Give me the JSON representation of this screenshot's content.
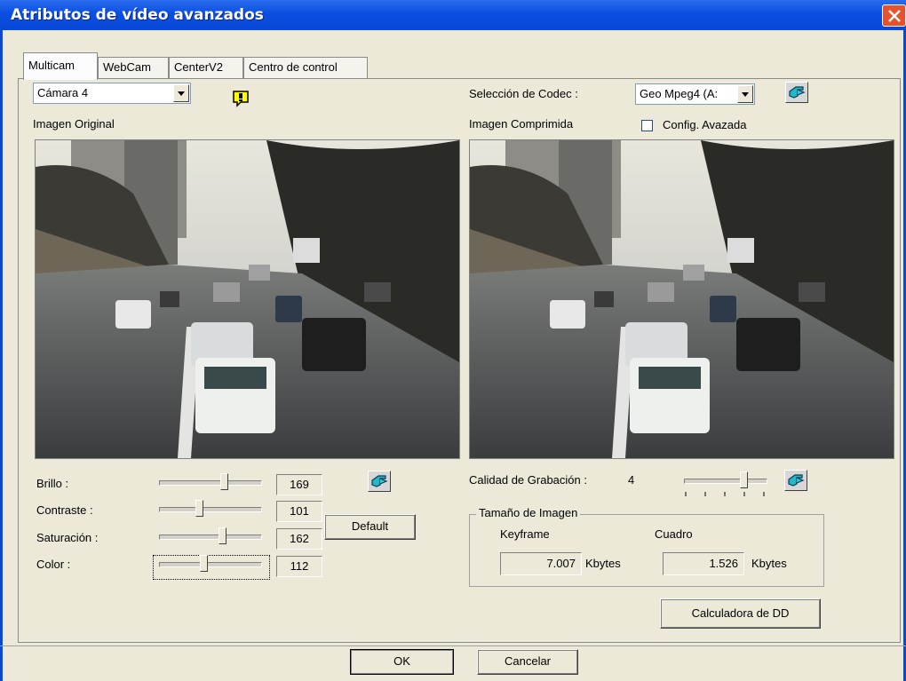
{
  "window": {
    "title": "Atributos de vídeo avanzados"
  },
  "tabs": [
    {
      "label": "Multicam",
      "active": true
    },
    {
      "label": "WebCam",
      "active": false
    },
    {
      "label": "CenterV2",
      "active": false
    },
    {
      "label": "Centro de control",
      "active": false
    }
  ],
  "camera_select": {
    "value": "Cámara 4"
  },
  "codec": {
    "label": "Selección de Codec :",
    "value": "Geo Mpeg4 (A:"
  },
  "original": {
    "label": "Imagen Original"
  },
  "compressed": {
    "label": "Imagen Comprimida",
    "advanced_config_label": "Config. Avazada",
    "advanced_config_checked": false
  },
  "adjustments": {
    "brightness": {
      "label": "Brillo :",
      "value": "169",
      "level": 0.66
    },
    "contrast": {
      "label": "Contraste :",
      "value": "101",
      "level": 0.39
    },
    "saturation": {
      "label": "Saturación :",
      "value": "162",
      "level": 0.64
    },
    "color": {
      "label": "Color :",
      "value": "112",
      "level": 0.44
    }
  },
  "default_button": "Default",
  "quality": {
    "label": "Calidad de Grabación :",
    "value": "4"
  },
  "image_size": {
    "title": "Tamaño de Imagen",
    "keyframe_label": "Keyframe",
    "frame_label": "Cuadro",
    "keyframe_value": "7.007",
    "frame_value": "1.526",
    "unit": "Kbytes"
  },
  "calc_button": "Calculadora de DD",
  "ok_button": "OK",
  "cancel_button": "Cancelar",
  "icons": {
    "warning": "warning-icon",
    "pointer": "pointing-hand-icon",
    "close": "close-icon"
  },
  "colors": {
    "titlebar": "#0a4fe0",
    "close": "#e4532b",
    "face": "#ece9d8"
  }
}
